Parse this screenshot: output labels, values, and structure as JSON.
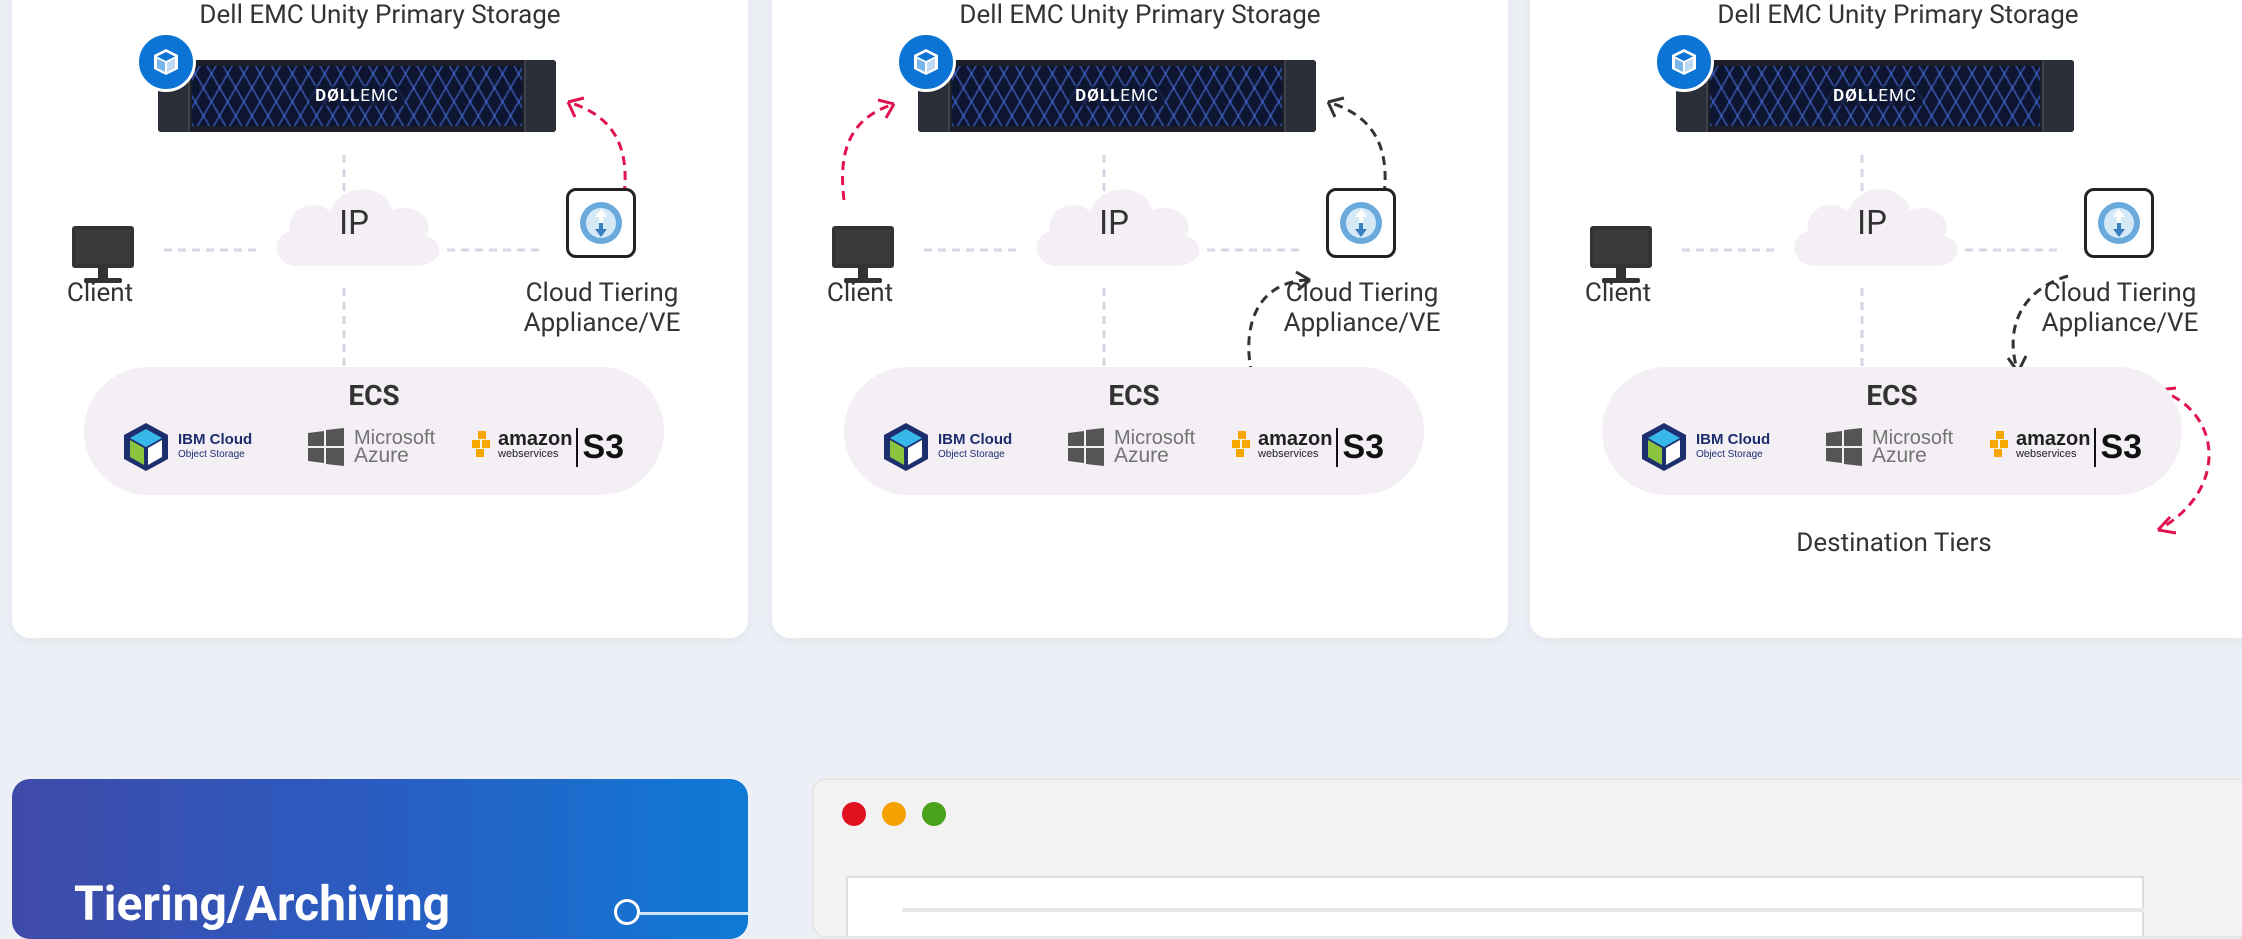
{
  "diagrams": [
    {
      "storage_label": "Dell EMC Unity Primary Storage",
      "storage_brand_dell": "DØLL",
      "storage_brand_emc": "EMC",
      "client_label": "Client",
      "cloud_label": "IP",
      "appliance_label_line1": "Cloud Tiering",
      "appliance_label_line2": "Appliance/VE",
      "ecs_label": "ECS",
      "vendors": {
        "ibm_line1": "IBM Cloud",
        "ibm_line2": "Object Storage",
        "ms_line1": "Microsoft",
        "ms_line2": "Azure",
        "aws_line1": "amazon",
        "aws_line2": "webservices",
        "s3": "S3"
      }
    },
    {
      "storage_label": "Dell EMC Unity Primary Storage",
      "storage_brand_dell": "DØLL",
      "storage_brand_emc": "EMC",
      "client_label": "Client",
      "cloud_label": "IP",
      "appliance_label_line1": "Cloud Tiering",
      "appliance_label_line2": "Appliance/VE",
      "ecs_label": "ECS",
      "vendors": {
        "ibm_line1": "IBM Cloud",
        "ibm_line2": "Object Storage",
        "ms_line1": "Microsoft",
        "ms_line2": "Azure",
        "aws_line1": "amazon",
        "aws_line2": "webservices",
        "s3": "S3"
      }
    },
    {
      "storage_label": "Dell EMC Unity Primary Storage",
      "storage_brand_dell": "DØLL",
      "storage_brand_emc": "EMC",
      "client_label": "Client",
      "cloud_label": "IP",
      "appliance_label_line1": "Cloud Tiering",
      "appliance_label_line2": "Appliance/VE",
      "ecs_label": "ECS",
      "vendors": {
        "ibm_line1": "IBM Cloud",
        "ibm_line2": "Object Storage",
        "ms_line1": "Microsoft",
        "ms_line2": "Azure",
        "aws_line1": "amazon",
        "aws_line2": "webservices",
        "s3": "S3"
      },
      "destination_label": "Destination Tiers"
    }
  ],
  "promo": {
    "title": "Tiering/Archiving"
  },
  "window": {
    "buttons": [
      "close",
      "minimize",
      "maximize"
    ]
  },
  "colors": {
    "accent_red": "#e0134f",
    "arrow_dark": "#333333",
    "promo_start": "#3f4aa8",
    "promo_end": "#0e7ad6",
    "dot_close": "#e0101e",
    "dot_minimize": "#f5a100",
    "dot_maximize": "#4aa21c"
  }
}
